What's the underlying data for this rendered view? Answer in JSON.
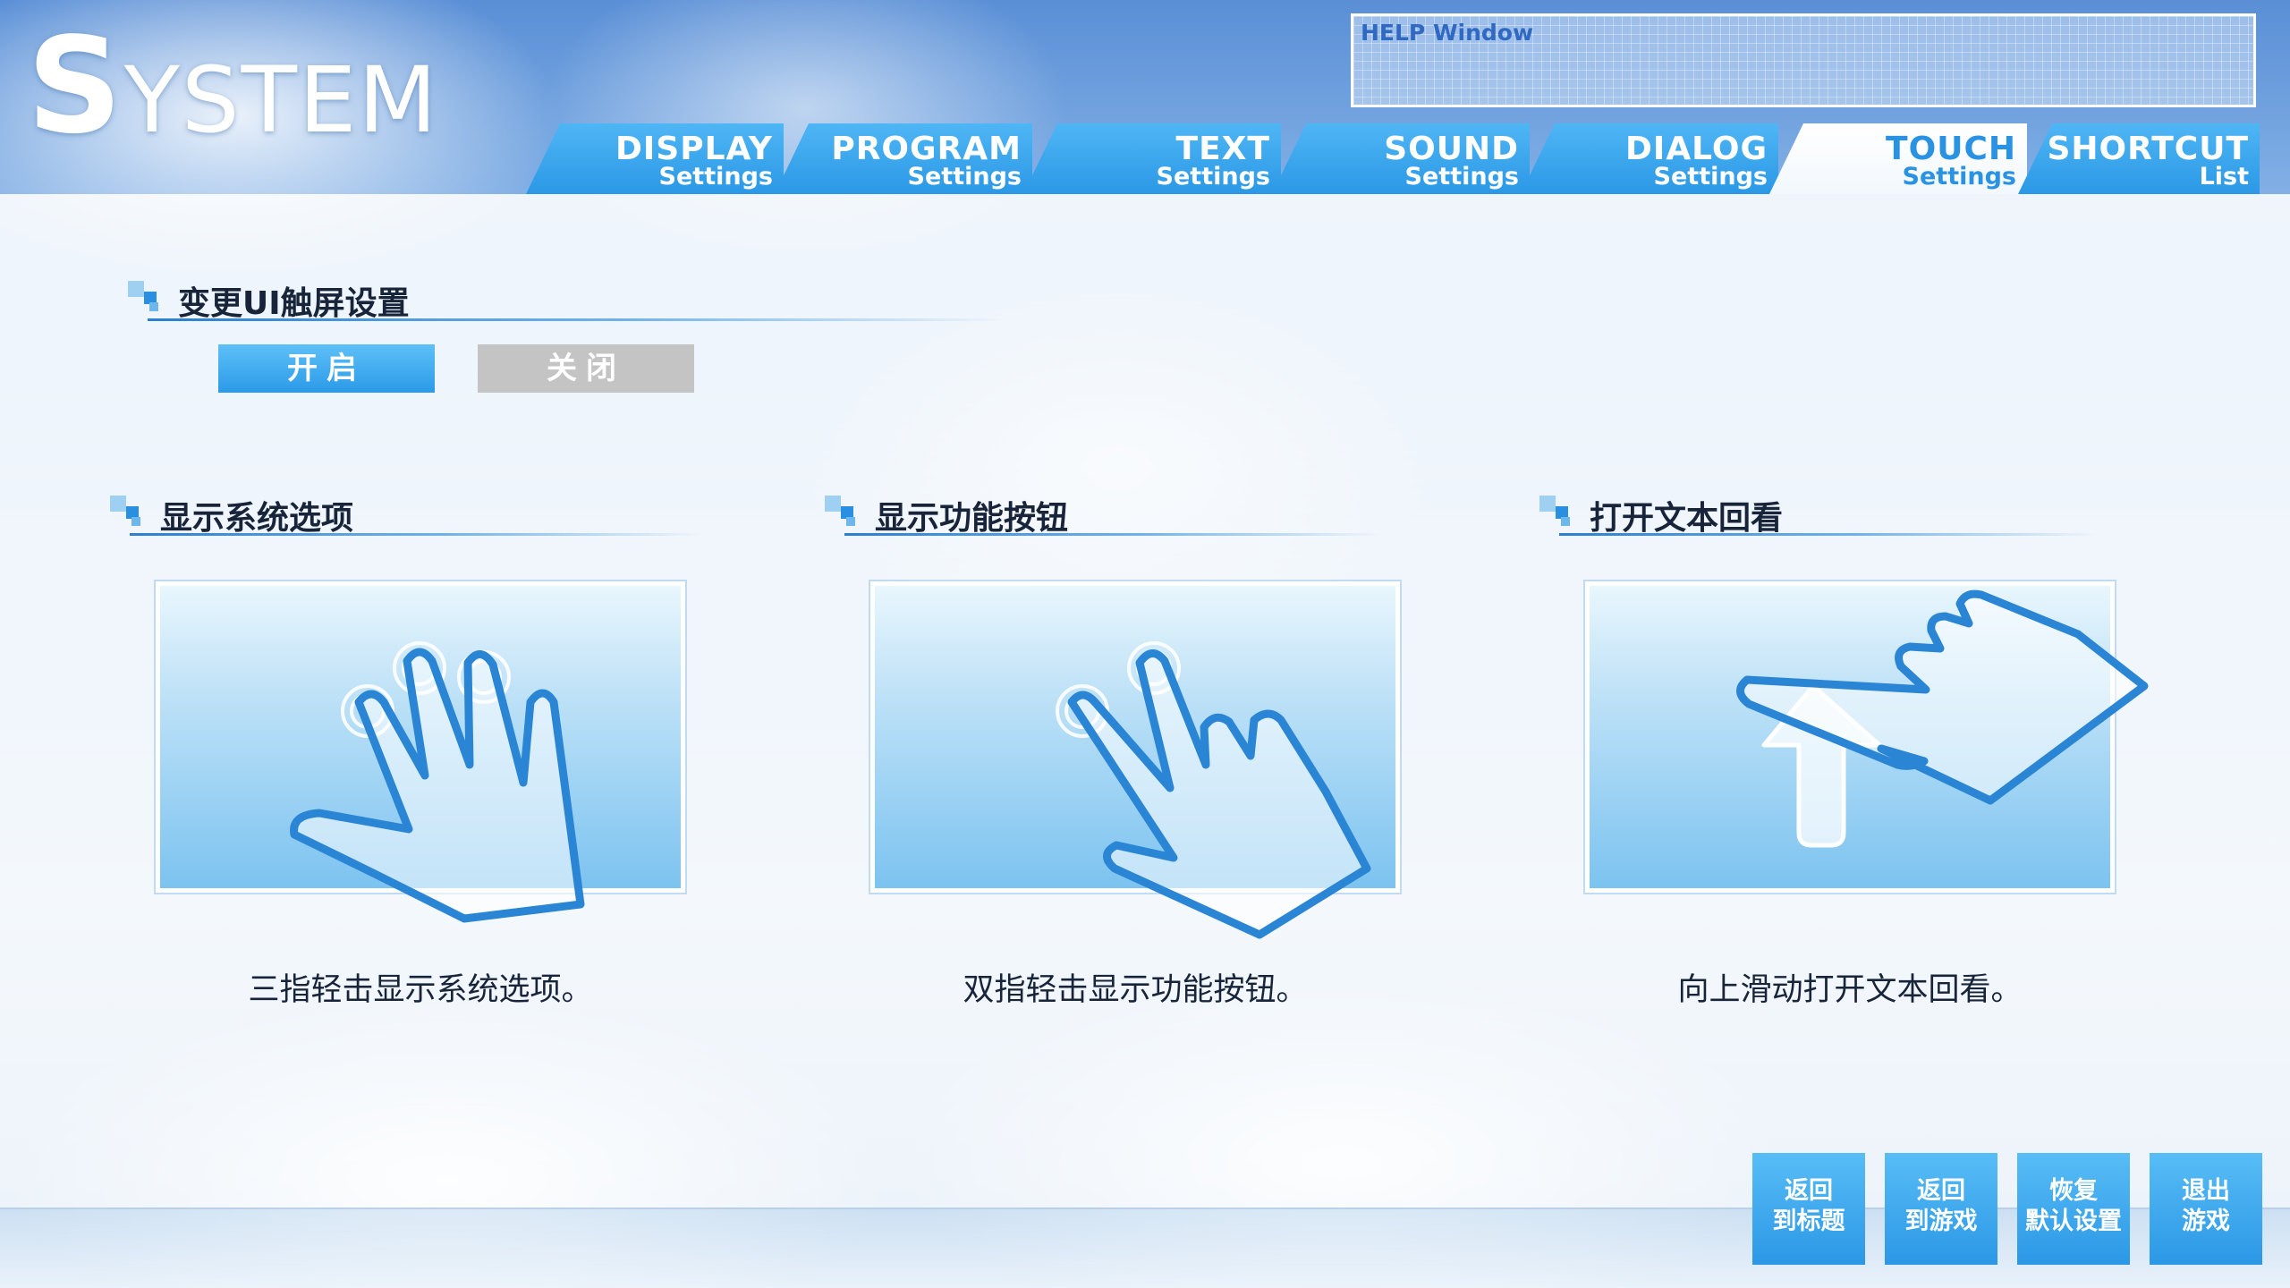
{
  "header": {
    "title_initial": "S",
    "title_rest": "YSTEM",
    "help_window_label": "HELP Window"
  },
  "tabs": [
    {
      "line1": "DISPLAY",
      "line2": "Settings",
      "active": false
    },
    {
      "line1": "PROGRAM",
      "line2": "Settings",
      "active": false
    },
    {
      "line1": "TEXT",
      "line2": "Settings",
      "active": false
    },
    {
      "line1": "SOUND",
      "line2": "Settings",
      "active": false
    },
    {
      "line1": "DIALOG",
      "line2": "Settings",
      "active": false
    },
    {
      "line1": "TOUCH",
      "line2": "Settings",
      "active": true
    },
    {
      "line1": "SHORTCUT",
      "line2": "List",
      "active": false
    }
  ],
  "touch_ui": {
    "heading": "变更UI触屏设置",
    "on_label": "开启",
    "off_label": "关闭",
    "selected": "开启"
  },
  "gestures": [
    {
      "heading": "显示系统选项",
      "caption": "三指轻击显示系统选项。",
      "icon": "three-finger-tap-icon"
    },
    {
      "heading": "显示功能按钮",
      "caption": "双指轻击显示功能按钮。",
      "icon": "two-finger-tap-icon"
    },
    {
      "heading": "打开文本回看",
      "caption": "向上滑动打开文本回看。",
      "icon": "swipe-up-icon"
    }
  ],
  "bottom_buttons": [
    {
      "line1": "返回",
      "line2": "到标题"
    },
    {
      "line1": "返回",
      "line2": "到游戏"
    },
    {
      "line1": "恢复",
      "line2": "默认设置"
    },
    {
      "line1": "退出",
      "line2": "游戏"
    }
  ],
  "colors": {
    "accent": "#2b98e6",
    "accent_light": "#4fb6f5",
    "off_button": "#c4c4c4",
    "heading_text": "#17243a",
    "active_tab_text": "#2a92e2"
  }
}
